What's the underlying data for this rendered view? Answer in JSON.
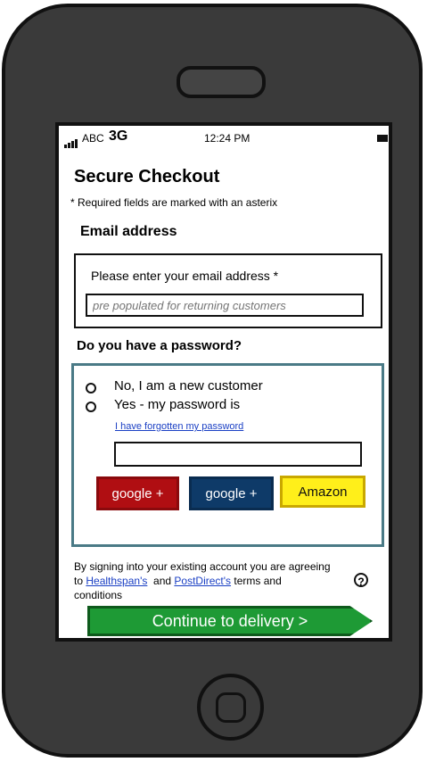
{
  "status_bar": {
    "carrier": "ABC",
    "network": "3G",
    "time": "12:24 PM"
  },
  "page": {
    "title": "Secure Checkout",
    "required_note": "* Required fields are marked with an asterix"
  },
  "email": {
    "heading": "Email address",
    "label": "Please enter your email address *",
    "placeholder": "pre populated for returning customers"
  },
  "password": {
    "heading": "Do you have a password?",
    "options": [
      {
        "label": "No, I am a new customer"
      },
      {
        "label": "Yes - my password is"
      }
    ],
    "forgot_link": "I have forgotten my password",
    "buttons": {
      "google1": "google +",
      "google2": "google +",
      "amazon": "Amazon"
    }
  },
  "terms": {
    "line1": "By signing into your existing account you are agreeing to",
    "link1": "Healthspan's",
    "and": "and",
    "link2": "PostDirect's",
    "line3": "terms and conditions",
    "help": "?"
  },
  "continue_button": "Continue to delivery >",
  "colors": {
    "google1": "#b00e12",
    "google2": "#0e3a68",
    "amazon": "#ffef1a",
    "continue": "#1e9a35",
    "link": "#1a3fc4",
    "password_box_border": "#4a7a86"
  },
  "icons": {
    "signal": "signal-icon",
    "battery": "battery-icon",
    "help": "help-icon",
    "speaker": "speaker-icon",
    "home": "home-button-icon"
  }
}
